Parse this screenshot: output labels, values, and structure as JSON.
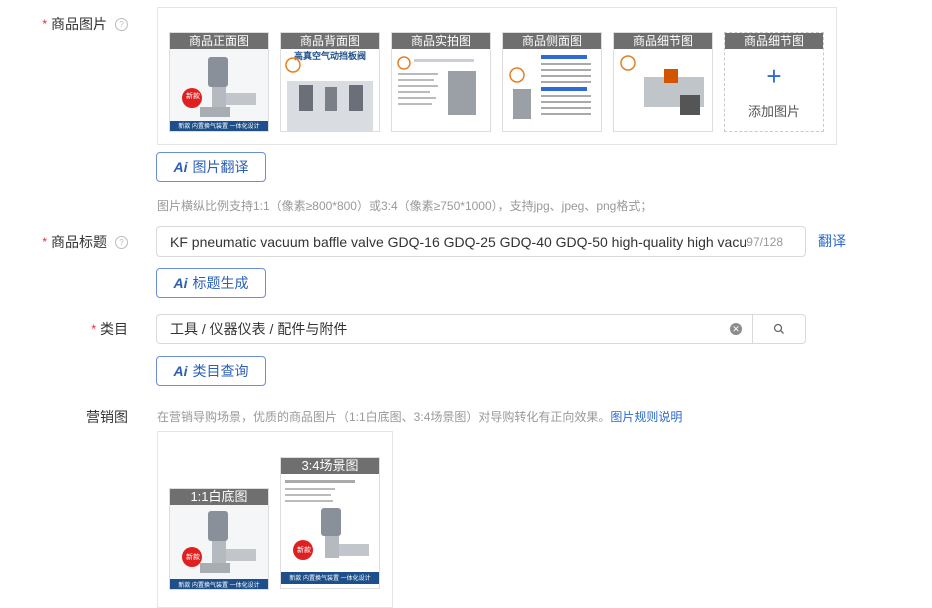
{
  "images": {
    "label": "商品图片",
    "thumbs": [
      {
        "caption": "商品正面图"
      },
      {
        "caption": "商品背面图"
      },
      {
        "caption": "商品实拍图"
      },
      {
        "caption": "商品侧面图"
      },
      {
        "caption": "商品细节图"
      },
      {
        "caption": "商品细节图"
      }
    ],
    "add_label": "添加图片",
    "translate_button": "图片翻译",
    "hint": "图片横纵比例支持1:1（像素≥800*800）或3:4（像素≥750*1000），支持jpg、jpeg、png格式；",
    "badge_new": "新款",
    "banner": "新款 内置换气装置 一体化设计",
    "back_title": "高真空气动挡板阀"
  },
  "title": {
    "label": "商品标题",
    "value": "KF pneumatic vacuum baffle valve GDQ-16 GDQ-25 GDQ-40 GDQ-50 high-quality high vacuum",
    "count": "97/128",
    "translate_link": "翻译",
    "generate_button": "标题生成"
  },
  "category": {
    "label": "类目",
    "value": "工具 / 仪器仪表 / 配件与附件",
    "query_button": "类目查询"
  },
  "marketing": {
    "label": "营销图",
    "hint": "在营销导购场景，优质的商品图片（1:1白底图、3:4场景图）对导购转化有正向效果。",
    "rules_link": "图片规则说明",
    "thumb1_caption": "1:1白底图",
    "thumb2_caption": "3:4场景图"
  },
  "ai_label": "Ai"
}
